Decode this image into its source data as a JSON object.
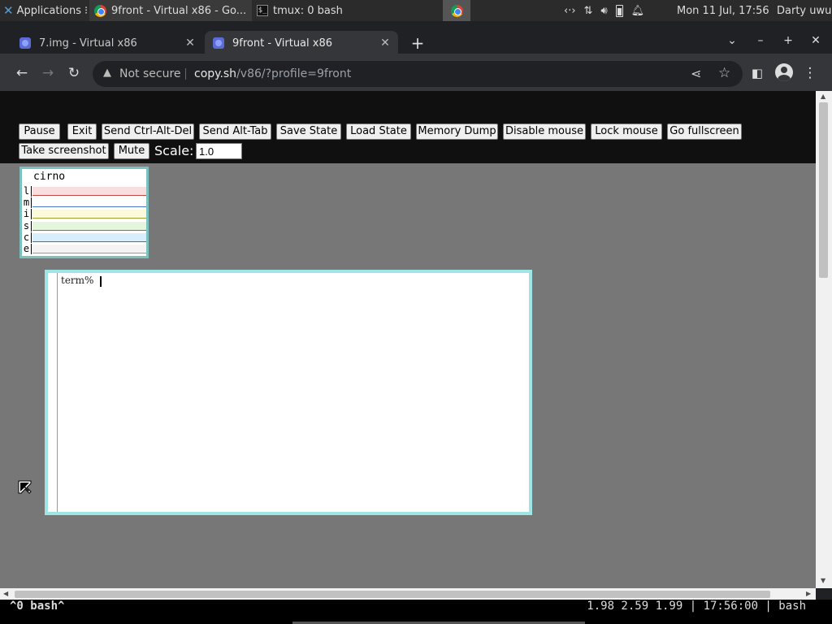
{
  "system_panel": {
    "applications_label": "Applications",
    "task_chrome": "9front - Virtual x86 - Go...",
    "task_terminal": "tmux: 0 bash",
    "clock": "Mon 11 Jul, 17:56",
    "user": "Darty uwu"
  },
  "browser": {
    "tabs": [
      {
        "label": "7.img - Virtual x86"
      },
      {
        "label": "9front - Virtual x86"
      }
    ],
    "omnibox": {
      "security": "Not secure",
      "host": "copy.sh",
      "path": "/v86/?profile=9front"
    }
  },
  "controls": {
    "pause": "Pause",
    "exit": "Exit",
    "ctrl_alt_del": "Send Ctrl-Alt-Del",
    "alt_tab": "Send Alt-Tab",
    "save_state": "Save State",
    "load_state": "Load State",
    "memory_dump": "Memory Dump",
    "disable_mouse": "Disable mouse",
    "lock_mouse": "Lock mouse",
    "fullscreen": "Go fullscreen",
    "screenshot": "Take screenshot",
    "mute": "Mute",
    "scale_label": "Scale:",
    "scale_value": "1.0"
  },
  "stats": {
    "title": "cirno",
    "rows": [
      {
        "label": "l",
        "color": "#f8dede",
        "line": "#c24848"
      },
      {
        "label": "m",
        "color": "#ffffff",
        "line": "#4a78c8"
      },
      {
        "label": "i",
        "color": "#fbfbdc",
        "line": "#a0a030"
      },
      {
        "label": "s",
        "color": "#e4f7dc",
        "line": "#3a9a3a"
      },
      {
        "label": "c",
        "color": "#d8eefc",
        "line": "#2a7ab8"
      },
      {
        "label": "e",
        "color": "#f4f4f4",
        "line": "#999999"
      }
    ]
  },
  "terminal": {
    "prompt": "term%"
  },
  "tmux": {
    "left": "^0 bash^",
    "right": "1.98 2.59 1.99 | 17:56:00 | bash"
  }
}
